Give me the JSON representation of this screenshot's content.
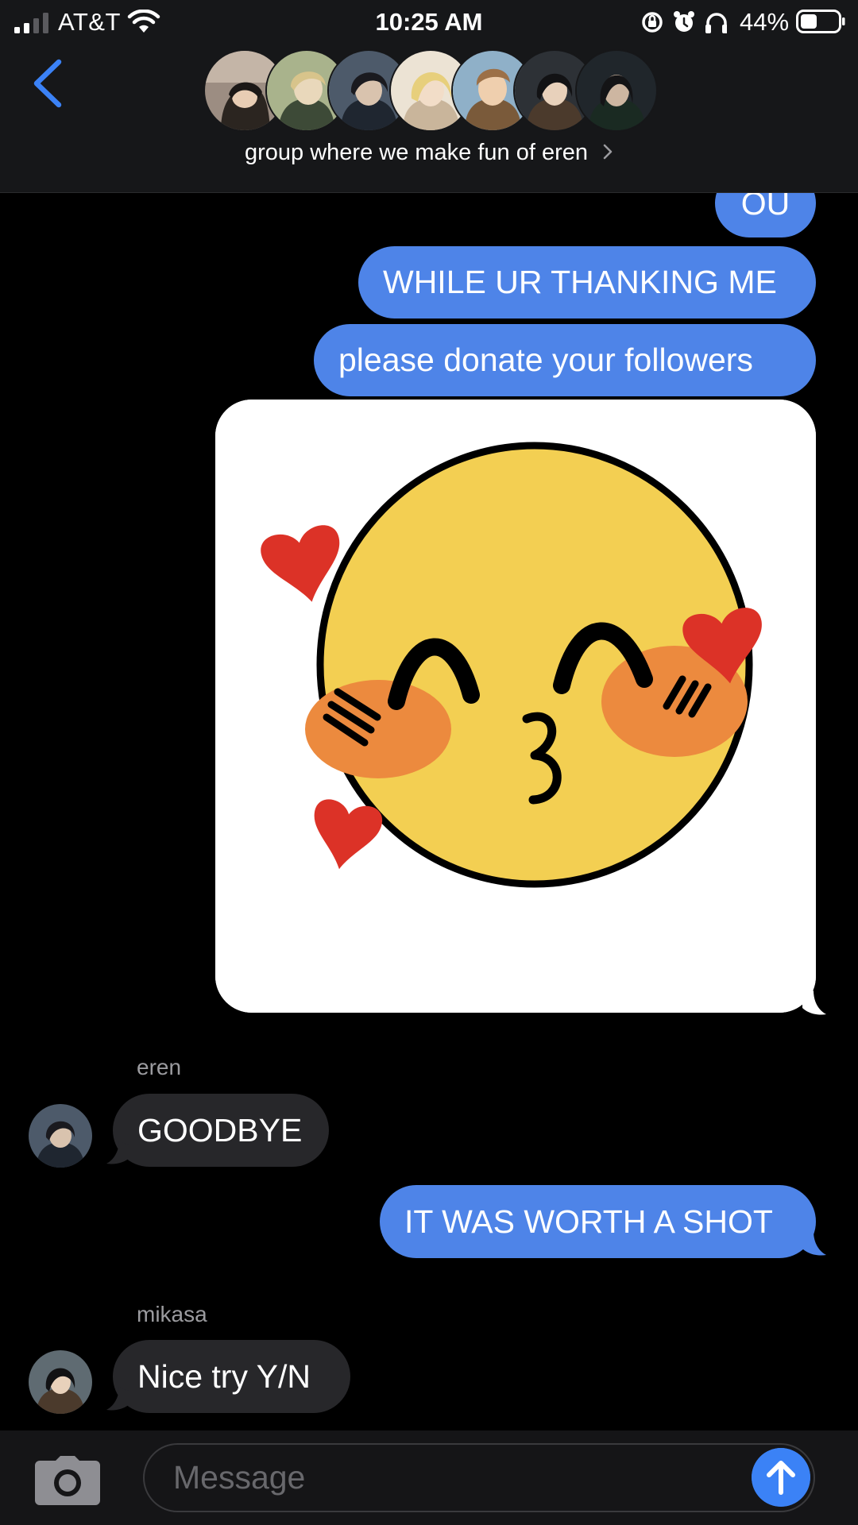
{
  "status_bar": {
    "carrier": "AT&T",
    "time": "10:25 AM",
    "battery_percent": "44%",
    "battery_level": 0.44,
    "icons": [
      "signal-icon",
      "wifi-icon",
      "orientation-lock-icon",
      "alarm-icon",
      "headphones-icon",
      "battery-icon"
    ]
  },
  "header": {
    "back_icon": "chevron-left-icon",
    "group_name": "group where we make fun of eren",
    "group_chevron_icon": "chevron-right-icon",
    "participant_count": 7
  },
  "messages": [
    {
      "direction": "outgoing",
      "type": "text",
      "text": "OU"
    },
    {
      "direction": "outgoing",
      "type": "text",
      "text": "WHILE UR THANKING ME"
    },
    {
      "direction": "outgoing",
      "type": "text",
      "text": "please donate your followers"
    },
    {
      "direction": "outgoing",
      "type": "image",
      "content": "blushing kissing face emoji with hearts"
    },
    {
      "direction": "incoming",
      "type": "text",
      "sender": "eren",
      "text": "GOODBYE"
    },
    {
      "direction": "outgoing",
      "type": "text",
      "text": "IT WAS WORTH A SHOT"
    },
    {
      "direction": "incoming",
      "type": "text",
      "sender": "mikasa",
      "text": "Nice try Y/N"
    }
  ],
  "composer": {
    "placeholder": "Message",
    "camera_icon": "camera-icon",
    "send_icon": "send-arrow-icon"
  },
  "colors": {
    "outgoing_bubble": "#4e84e8",
    "incoming_bubble": "#27272a",
    "accent": "#3b82f6",
    "background": "#000000"
  }
}
